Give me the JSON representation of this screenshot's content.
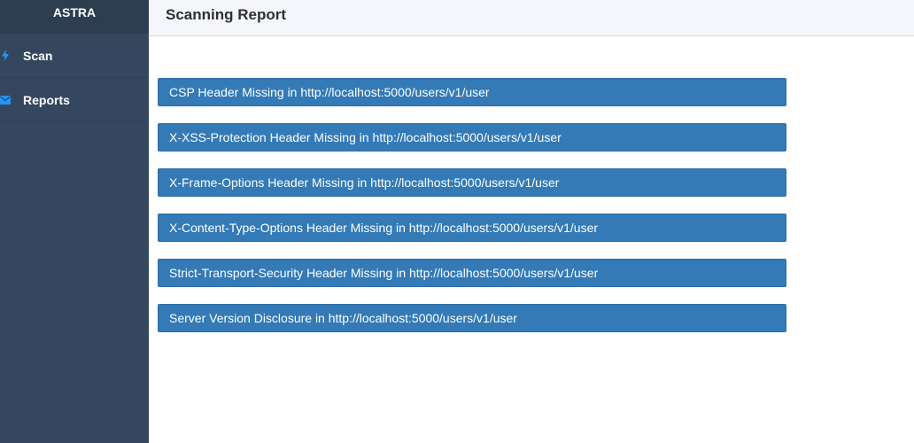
{
  "sidebar": {
    "brand": "ASTRA",
    "items": [
      {
        "label": "Scan",
        "icon": "bolt-icon"
      },
      {
        "label": "Reports",
        "icon": "envelope-icon"
      }
    ]
  },
  "header": {
    "title": "Scanning Report"
  },
  "report": {
    "items": [
      {
        "label": "CSP Header Missing in http://localhost:5000/users/v1/user"
      },
      {
        "label": "X-XSS-Protection Header Missing in http://localhost:5000/users/v1/user"
      },
      {
        "label": "X-Frame-Options Header Missing in http://localhost:5000/users/v1/user"
      },
      {
        "label": "X-Content-Type-Options Header Missing in http://localhost:5000/users/v1/user"
      },
      {
        "label": "Strict-Transport-Security Header Missing in http://localhost:5000/users/v1/user"
      },
      {
        "label": "Server Version Disclosure in http://localhost:5000/users/v1/user"
      }
    ]
  },
  "colors": {
    "sidebar_bg": "#34475e",
    "brand_bg": "#2c3e50",
    "accent_icon": "#2196f3",
    "item_bg": "#337ab7",
    "header_bg": "#f4f6fb"
  }
}
